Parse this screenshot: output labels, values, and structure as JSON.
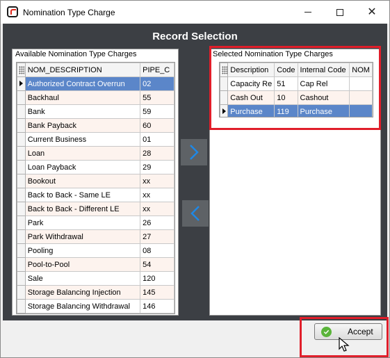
{
  "window": {
    "title": "Nomination Type Charge",
    "minimize_icon": "minimize-icon",
    "maximize_icon": "maximize-icon",
    "close_icon": "close-icon"
  },
  "header": {
    "title": "Record Selection"
  },
  "available": {
    "label": "Available Nomination Type Charges",
    "columns": [
      "NOM_DESCRIPTION",
      "PIPE_C"
    ],
    "rows": [
      [
        "Authorized Contract Overrun",
        "02"
      ],
      [
        "Backhaul",
        "55"
      ],
      [
        "Bank",
        "59"
      ],
      [
        "Bank Payback",
        "60"
      ],
      [
        "Current Business",
        "01"
      ],
      [
        "Loan",
        "28"
      ],
      [
        "Loan Payback",
        "29"
      ],
      [
        "Bookout",
        "xx"
      ],
      [
        "Back to Back - Same LE",
        "xx"
      ],
      [
        "Back to Back - Different LE",
        "xx"
      ],
      [
        "Park",
        "26"
      ],
      [
        "Park Withdrawal",
        "27"
      ],
      [
        "Pooling",
        "08"
      ],
      [
        "Pool-to-Pool",
        "54"
      ],
      [
        "Sale",
        "120"
      ],
      [
        "Storage Balancing Injection",
        "145"
      ],
      [
        "Storage Balancing Withdrawal",
        "146"
      ]
    ],
    "selected_row": 0
  },
  "selected": {
    "label": "Selected Nomination Type Charges",
    "columns": [
      "Description",
      "Code",
      "Internal Code",
      "NOM"
    ],
    "rows": [
      [
        "Capacity Re",
        "51",
        "Cap Rel",
        ""
      ],
      [
        "Cash Out",
        "10",
        "Cashout",
        ""
      ],
      [
        "Purchase",
        "119",
        "Purchase",
        ""
      ]
    ],
    "selected_row": 2
  },
  "buttons": {
    "move_right_icon": "chevron-right-icon",
    "move_left_icon": "chevron-left-icon",
    "accept_label": "Accept",
    "accept_icon": "check-circle-icon"
  },
  "colors": {
    "dialog_bg": "#3c3f44",
    "selection": "#5b86c9",
    "highlight": "#e01e2a",
    "arrow_glyph": "#1e88e5"
  }
}
